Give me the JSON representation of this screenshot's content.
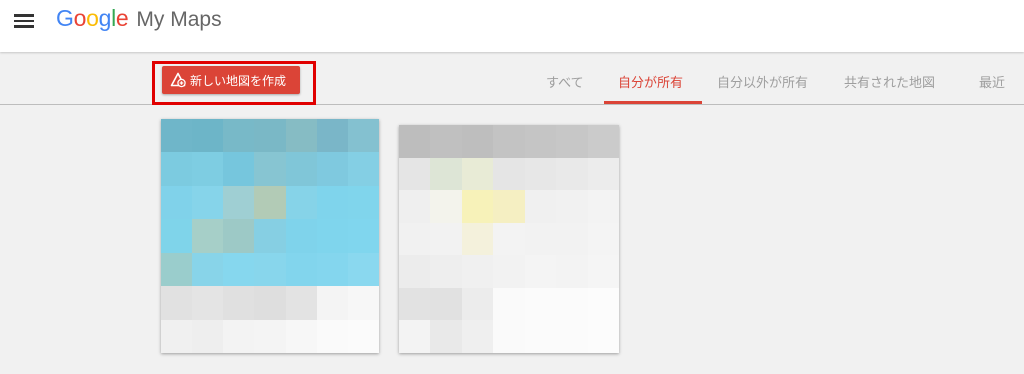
{
  "header": {
    "logo_google": "Google",
    "product_name": "My Maps",
    "menu_icon": "hamburger-menu-icon"
  },
  "toolbar": {
    "create_button_label": "新しい地図を作成",
    "create_button_icon": "add-map-icon",
    "accent_color": "#db4437",
    "tabs": [
      {
        "label": "すべて",
        "active": false
      },
      {
        "label": "自分が所有",
        "active": true
      },
      {
        "label": "自分以外が所有",
        "active": false
      },
      {
        "label": "共有された地図",
        "active": false
      },
      {
        "label": "最近",
        "active": false
      }
    ]
  },
  "maps": [
    {
      "thumbnail_colors": [
        [
          "#6fb6c9",
          "#6db5c8",
          "#78b9c8",
          "#7ab8c6",
          "#86bcc4",
          "#7ab6c8",
          "#84c1d0"
        ],
        [
          "#7ccbe0",
          "#7ecde2",
          "#76c6dd",
          "#87c5d2",
          "#80c6d8",
          "#7fc9df",
          "#84cfe4"
        ],
        [
          "#80d2ea",
          "#86d4ea",
          "#9fcfd3",
          "#b2cbb6",
          "#86d3e8",
          "#7fd4ec",
          "#80d5ec"
        ],
        [
          "#7fd4ea",
          "#a6cfc8",
          "#9dc9c6",
          "#86cfe3",
          "#7fd3eb",
          "#7fd5ed",
          "#80d6ee"
        ],
        [
          "#9acdcc",
          "#88d4e9",
          "#86d7ee",
          "#88d6ec",
          "#82d5ed",
          "#84d6ee",
          "#8ad8ef"
        ],
        [
          "#e1e1e1",
          "#e4e4e4",
          "#e0e0e0",
          "#dedede",
          "#e3e3e3",
          "#f4f4f4",
          "#f7f7f7"
        ],
        [
          "#f0f0f0",
          "#eeeeee",
          "#f3f3f3",
          "#f4f4f4",
          "#f7f7f7",
          "#fafafa",
          "#fbfbfb"
        ]
      ]
    },
    {
      "thumbnail_colors": [
        [
          "#bdbdbd",
          "#c0c0c0",
          "#bebebe",
          "#c3c3c3",
          "#c5c5c5",
          "#c7c7c7",
          "#cbcbcb"
        ],
        [
          "#e5e5e5",
          "#dde5d6",
          "#e8ebd6",
          "#e5e5e5",
          "#e7e7e7",
          "#e9e9e9",
          "#ececec"
        ],
        [
          "#efefef",
          "#f3f3ec",
          "#f7f2b9",
          "#f5efc2",
          "#f0f0f0",
          "#f1f1f1",
          "#f3f3f3"
        ],
        [
          "#f1f1f1",
          "#f2f2f2",
          "#f4f1dc",
          "#f3f3f3",
          "#f2f2f2",
          "#f2f2f2",
          "#f4f4f4"
        ],
        [
          "#ececec",
          "#eeeeee",
          "#f0f0f0",
          "#f2f2f2",
          "#f4f4f4",
          "#f3f3f3",
          "#f5f5f5"
        ],
        [
          "#e2e2e2",
          "#e1e1e1",
          "#ececec",
          "#fafafa",
          "#fbfbfb",
          "#fbfbfb",
          "#fcfcfc"
        ],
        [
          "#f3f3f3",
          "#e9e9e9",
          "#efefef",
          "#fafafa",
          "#fbfbfb",
          "#fbfbfb",
          "#fcfcfc"
        ]
      ]
    }
  ]
}
